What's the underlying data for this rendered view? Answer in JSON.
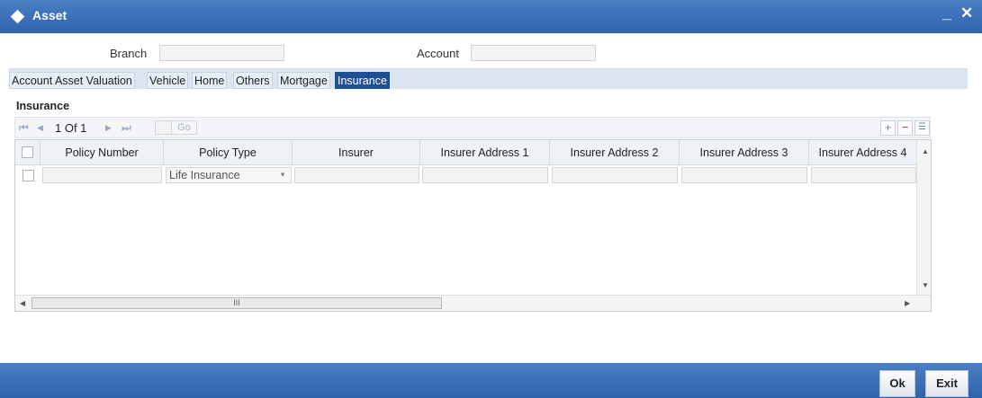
{
  "window": {
    "title": "Asset",
    "minimize_glyph": "_",
    "close_glyph": "✕"
  },
  "form": {
    "branch_label": "Branch",
    "branch_value": "",
    "account_label": "Account",
    "account_value": ""
  },
  "tabs": [
    {
      "label": "Account Asset Valuation",
      "active": false
    },
    {
      "label": "Vehicle",
      "active": false
    },
    {
      "label": "Home",
      "active": false
    },
    {
      "label": "Others",
      "active": false
    },
    {
      "label": "Mortgage",
      "active": false
    },
    {
      "label": "Insurance",
      "active": true
    }
  ],
  "section": {
    "title": "Insurance"
  },
  "pagination": {
    "first": "⏮",
    "prev": "◀",
    "page_info": "1 Of 1",
    "next": "▶",
    "last": "⏭",
    "goto_value": "",
    "go_label": "Go"
  },
  "toolbar": {
    "add_glyph": "+",
    "remove_glyph": "−",
    "list_glyph": "☰"
  },
  "grid": {
    "columns": [
      "Policy Number",
      "Policy Type",
      "Insurer",
      "Insurer Address 1",
      "Insurer Address 2",
      "Insurer Address 3",
      "Insurer Address 4"
    ],
    "rows": [
      {
        "policy_number": "",
        "policy_type": "Life Insurance",
        "insurer": "",
        "address1": "",
        "address2": "",
        "address3": "",
        "address4": ""
      }
    ],
    "hscroll_grip": "III"
  },
  "footer": {
    "ok_label": "Ok",
    "exit_label": "Exit"
  },
  "colors": {
    "titlebar": "#2f63ab",
    "active_tab": "#1f4f93",
    "tabstrip": "#dbe5f1"
  }
}
